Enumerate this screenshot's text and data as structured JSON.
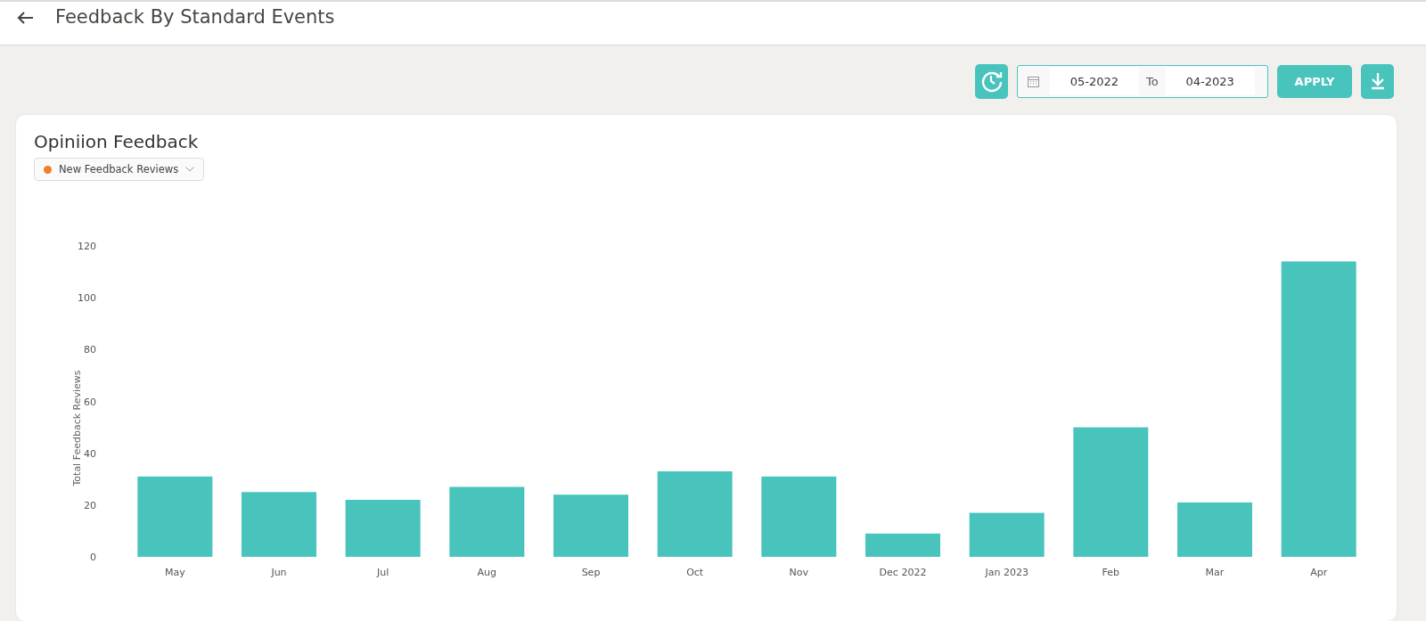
{
  "header": {
    "title": "Feedback By Standard Events"
  },
  "toolbar": {
    "from": "05-2022",
    "separator": "To",
    "to": "04-2023",
    "apply": "APPLY"
  },
  "card": {
    "title": "Opiniion Feedback",
    "legend": {
      "color": "#f47c2c"
    },
    "chart_data": {
      "type": "bar",
      "ylabel": "Total Feedback Reviews",
      "categories": [
        "May",
        "Jun",
        "Jul",
        "Aug",
        "Sep",
        "Oct",
        "Nov",
        "Dec 2022",
        "Jan 2023",
        "Feb",
        "Mar",
        "Apr"
      ],
      "series": [
        {
          "name": "New Feedback Reviews",
          "color": "#48c4bd",
          "values": [
            31,
            25,
            22,
            27,
            24,
            33,
            31,
            9,
            17,
            50,
            21,
            114
          ]
        }
      ],
      "ylim": [
        0,
        120
      ],
      "yticks": [
        0,
        20,
        40,
        60,
        80,
        100,
        120
      ]
    }
  }
}
